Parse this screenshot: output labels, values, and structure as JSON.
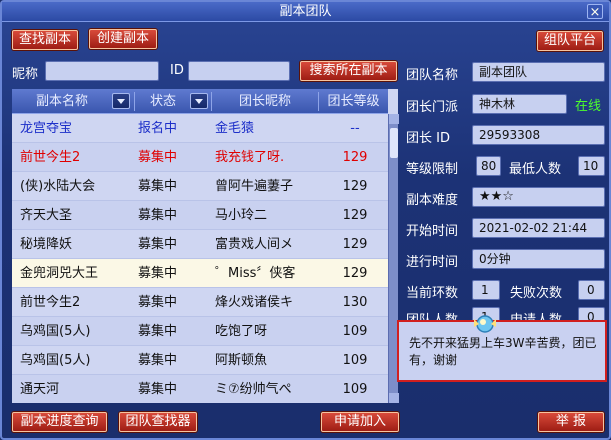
{
  "window": {
    "title": "副本团队",
    "close": "×"
  },
  "toolbar": {
    "find_dungeon": "查找副本",
    "create_dungeon": "创建副本",
    "team_platform": "组队平台"
  },
  "search": {
    "nickname_label": "昵称",
    "nickname_value": "",
    "id_label": "ID",
    "id_value": "",
    "search_button": "搜索所在副本"
  },
  "table": {
    "headers": [
      "副本名称",
      "状态",
      "团长昵称",
      "团长等级"
    ],
    "rows": [
      {
        "name": "龙宫夺宝",
        "status": "报名中",
        "leader": "金毛猿",
        "level": "--",
        "style": "blue"
      },
      {
        "name": "前世今生2",
        "status": "募集中",
        "leader": "我充钱了呀.",
        "level": "129",
        "style": "red"
      },
      {
        "name": "(侠)水陆大会",
        "status": "募集中",
        "leader": "曾阿牛遍萋子",
        "level": "129",
        "style": "normal"
      },
      {
        "name": "齐天大圣",
        "status": "募集中",
        "leader": "马小玲二",
        "level": "129",
        "style": "normal"
      },
      {
        "name": "秘境降妖",
        "status": "募集中",
        "leader": "富贵戏人间メ",
        "level": "129",
        "style": "normal"
      },
      {
        "name": "金兜洞兕大王",
        "status": "募集中",
        "leader": "゜Miss〞侠客",
        "level": "129",
        "style": "selected"
      },
      {
        "name": "前世今生2",
        "status": "募集中",
        "leader": "烽火戏诸侯キ",
        "level": "130",
        "style": "normal"
      },
      {
        "name": "乌鸡国(5人)",
        "status": "募集中",
        "leader": "吃饱了呀",
        "level": "109",
        "style": "normal"
      },
      {
        "name": "乌鸡国(5人)",
        "status": "募集中",
        "leader": "阿斯顿魚",
        "level": "109",
        "style": "normal"
      },
      {
        "name": "通天河",
        "status": "募集中",
        "leader": "ミ⑦纷帅气ぺ",
        "level": "109",
        "style": "normal"
      }
    ]
  },
  "details": {
    "team_name_label": "团队名称",
    "team_name": "副本团队",
    "leader_school_label": "团长门派",
    "leader_school": "神木林",
    "online_status": "在线",
    "leader_id_label": "团长  ID",
    "leader_id": "29593308",
    "level_limit_label": "等级限制",
    "level_limit": "80",
    "min_people_label": "最低人数",
    "min_people": "10",
    "difficulty_label": "副本难度",
    "difficulty": "★★☆",
    "start_time_label": "开始时间",
    "start_time": "2021-02-02 21:44",
    "elapsed_label": "进行时间",
    "elapsed": "0分钟",
    "current_round_label": "当前环数",
    "current_round": "1",
    "fail_count_label": "失败次数",
    "fail_count": "0",
    "team_count_label": "团队人数",
    "team_count": "1",
    "apply_count_label": "申请人数",
    "apply_count": "0",
    "message": "先不开来猛男上车3W辛苦费，团已有，谢谢"
  },
  "bottom": {
    "progress_query": "副本进度查询",
    "team_finder": "团队查找器",
    "apply_join": "申请加入",
    "report": "举 报"
  },
  "colors": {
    "red_text": "#e00000",
    "blue_text": "#1d2fc9",
    "online": "#4cff2c",
    "button_red": "#b2281c"
  }
}
